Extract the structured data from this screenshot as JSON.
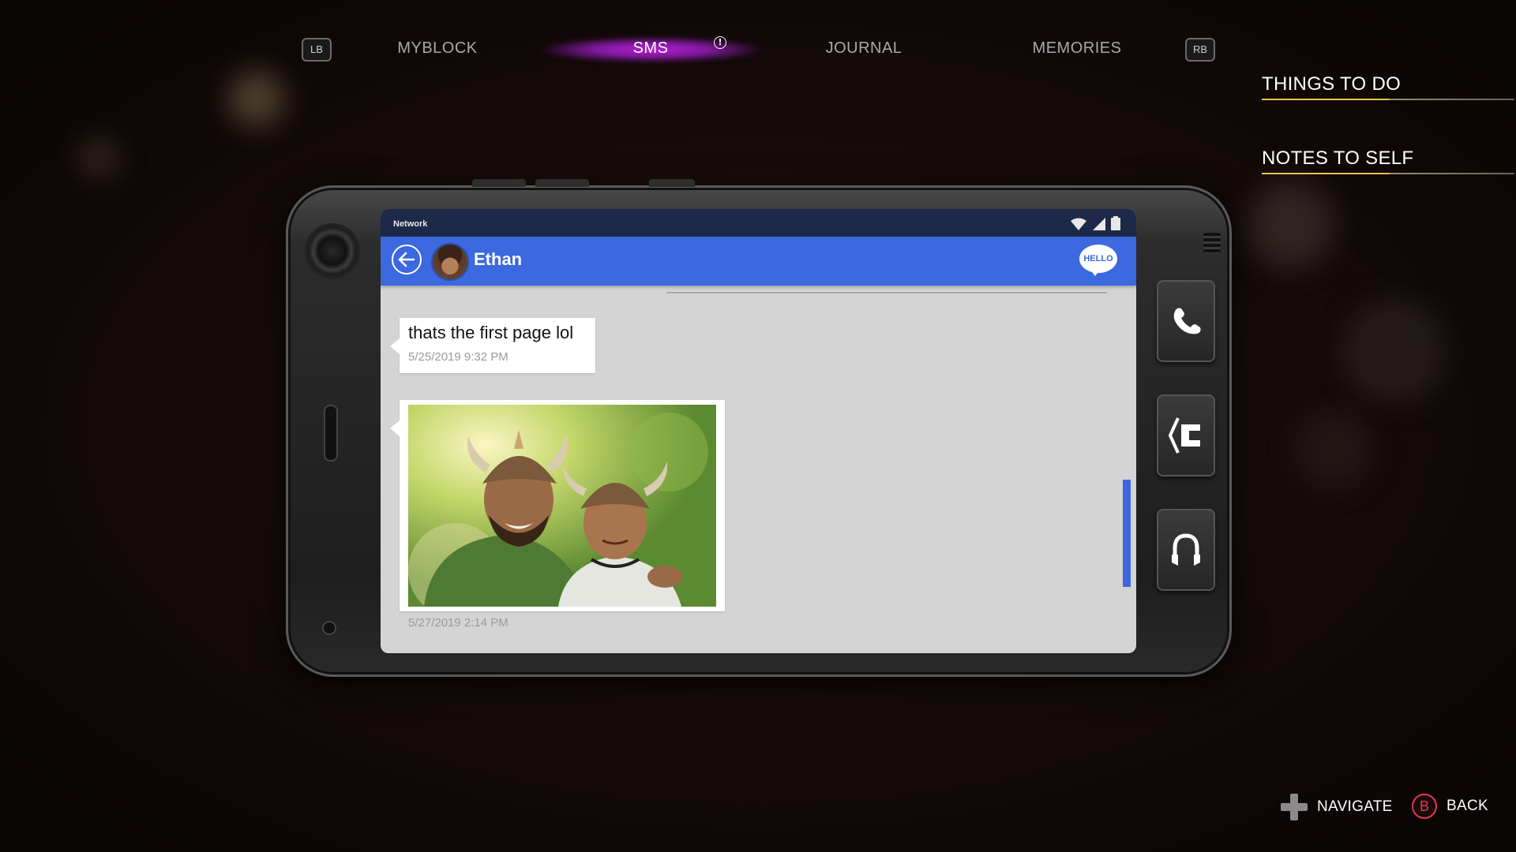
{
  "top_nav": {
    "left_bumper": "LB",
    "right_bumper": "RB",
    "tabs": [
      {
        "label": "MYBLOCK"
      },
      {
        "label": "SMS"
      },
      {
        "label": "JOURNAL"
      },
      {
        "label": "MEMORIES"
      }
    ],
    "active_tab": "SMS",
    "sms_alert": "!"
  },
  "side_menu": {
    "items": [
      {
        "label": "THINGS TO DO"
      },
      {
        "label": "NOTES TO SELF"
      }
    ]
  },
  "phone": {
    "status_bar": {
      "network": "Network"
    },
    "chat": {
      "contact_name": "Ethan",
      "hello_badge": "HELLO",
      "messages": [
        {
          "type": "text",
          "text": "thats the first page lol",
          "timestamp": "5/25/2019 9:32 PM"
        },
        {
          "type": "image",
          "timestamp": "5/27/2019 2:14 PM"
        }
      ]
    }
  },
  "prompts": {
    "navigate": "NAVIGATE",
    "back_button": "B",
    "back": "BACK"
  }
}
